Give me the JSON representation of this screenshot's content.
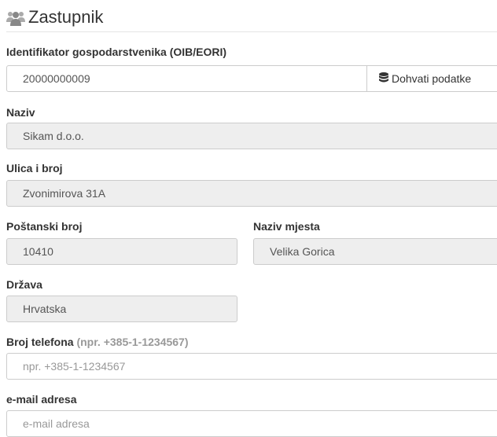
{
  "header": {
    "title": "Zastupnik",
    "icon": "users-icon"
  },
  "oib": {
    "label": "Identifikator gospodarstvenika (OIB/EORI)",
    "value": "20000000009",
    "button_label": "Dohvati podatke",
    "button_icon": "database-icon"
  },
  "naziv": {
    "label": "Naziv",
    "value": "Sikam d.o.o."
  },
  "ulica": {
    "label": "Ulica i broj",
    "value": "Zvonimirova 31A"
  },
  "postanski": {
    "label": "Poštanski broj",
    "value": "10410"
  },
  "mjesto": {
    "label": "Naziv mjesta",
    "value": "Velika Gorica"
  },
  "drzava": {
    "label": "Država",
    "value": "Hrvatska"
  },
  "telefon": {
    "label": "Broj telefona",
    "hint": "(npr. +385-1-1234567)",
    "placeholder": "npr. +385-1-1234567",
    "value": ""
  },
  "email": {
    "label": "e-mail adresa",
    "placeholder": "e-mail adresa",
    "value": ""
  }
}
